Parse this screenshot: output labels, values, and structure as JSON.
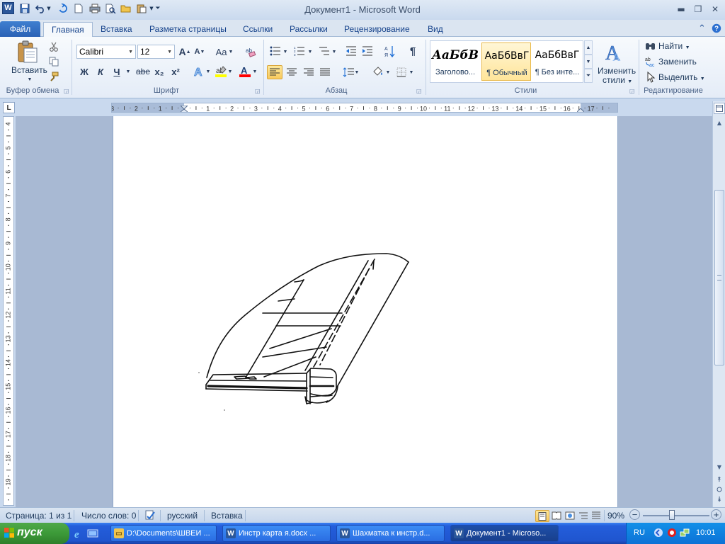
{
  "window": {
    "title": "Документ1  -  Microsoft Word",
    "logo_letter": "W"
  },
  "tabs": {
    "file": "Файл",
    "items": [
      "Главная",
      "Вставка",
      "Разметка страницы",
      "Ссылки",
      "Рассылки",
      "Рецензирование",
      "Вид"
    ]
  },
  "ribbon": {
    "clipboard": {
      "paste": "Вставить",
      "label": "Буфер обмена"
    },
    "font": {
      "name": "Calibri",
      "size": "12",
      "grow": "A",
      "shrink": "A",
      "case": "Aa",
      "bold": "Ж",
      "italic": "К",
      "underline": "Ч",
      "strike": "abe",
      "sub": "x₂",
      "sup": "x²",
      "label": "Шрифт"
    },
    "paragraph": {
      "label": "Абзац",
      "pilcrow": "¶"
    },
    "styles": {
      "label": "Стили",
      "items": [
        {
          "preview": "АаБбВ",
          "name": "Заголово..."
        },
        {
          "preview": "АаБбВвГ",
          "name": "¶ Обычный"
        },
        {
          "preview": "АаБбВвГ",
          "name": "¶ Без инте..."
        }
      ],
      "change_line1": "Изменить",
      "change_line2": "стили"
    },
    "editing": {
      "find": "Найти",
      "replace": "Заменить",
      "select": "Выделить",
      "label": "Редактирование"
    }
  },
  "ruler": {
    "corner": "L",
    "h_numbers": [
      "3",
      "2",
      "1",
      "1",
      "2",
      "3",
      "4",
      "5",
      "6",
      "7",
      "8",
      "9",
      "10",
      "11",
      "12",
      "13",
      "14",
      "15",
      "16",
      "17"
    ],
    "v_numbers": [
      "4",
      "5",
      "6",
      "7",
      "8",
      "9",
      "10",
      "11",
      "12",
      "13",
      "14",
      "15",
      "16",
      "17",
      "18",
      "19"
    ]
  },
  "status": {
    "page": "Страница: 1 из 1",
    "words": "Число слов: 0",
    "language": "русский",
    "mode": "Вставка",
    "zoom": "90%",
    "zoom_minus": "−",
    "zoom_plus": "+"
  },
  "taskbar": {
    "start": "пуск",
    "tasks": [
      {
        "label": "D:\\Documents\\ШВЕИ ...",
        "icon": "folder-icon"
      },
      {
        "label": "Инстр карта я.docx ...",
        "icon": "word-icon"
      },
      {
        "label": "Шахматка к инстр.d...",
        "icon": "word-icon"
      },
      {
        "label": "Документ1 - Microso...",
        "icon": "word-icon"
      }
    ],
    "language": "RU",
    "clock": "10:01"
  },
  "colors": {
    "ribbon_accent": "#2b579a",
    "file_tab": "#2a62b6",
    "taskbar": "#245edb",
    "start_button": "#3c9a38",
    "highlight": "#ffff00",
    "font_color": "#ff0000"
  }
}
